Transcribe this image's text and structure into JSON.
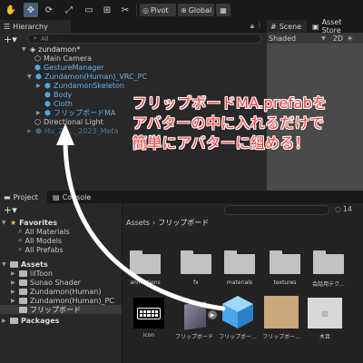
{
  "toolbar": {
    "pivot_label": "Pivot",
    "global_label": "Global",
    "store_label": "Asset Store"
  },
  "hierarchy": {
    "tab_label": "Hierarchy",
    "search_placeholder": "All",
    "scene_name": "zundamon*",
    "items": [
      {
        "label": "Main Camera"
      },
      {
        "label": "GestureManager"
      },
      {
        "label": "Zundamon(Human)_VRC_PC"
      },
      {
        "label": "ZundamonSkeleton"
      },
      {
        "label": "Body"
      },
      {
        "label": "Cloth"
      },
      {
        "label": "フリップボードMA"
      },
      {
        "label": "Directional Light"
      },
      {
        "label": "Hu_Zu..._2023_Meta"
      }
    ]
  },
  "scene": {
    "tab_scene": "Scene",
    "tab_store": "Asset Store",
    "shading": "Shaded",
    "mode_2d": "2D"
  },
  "annotation": {
    "line1": "フリップボードMA.prefabを",
    "line2": "アバターの中に入れるだけで",
    "line3": "簡単にアバターに組める！"
  },
  "project": {
    "tab_project": "Project",
    "tab_console": "Console",
    "breadcrumb_root": "Assets",
    "breadcrumb_sep": "›",
    "breadcrumb_current": "フリップボード",
    "count": "14",
    "favorites_label": "Favorites",
    "favorites": [
      {
        "label": "All Materials"
      },
      {
        "label": "All Models"
      },
      {
        "label": "All Prefabs"
      }
    ],
    "assets_label": "Assets",
    "folders": [
      {
        "label": "lilToon"
      },
      {
        "label": "Sunao Shader"
      },
      {
        "label": "Zundamon(Human)"
      },
      {
        "label": "Zundamon(Human)_PC"
      },
      {
        "label": "フリップボード"
      }
    ],
    "packages_label": "Packages",
    "grid_row1": [
      {
        "label": "animations"
      },
      {
        "label": "fx"
      },
      {
        "label": "materials"
      },
      {
        "label": "textures"
      },
      {
        "label": "会話用テク..."
      }
    ],
    "grid_row2": [
      {
        "label": "icon"
      },
      {
        "label": "フリップボード"
      },
      {
        "label": "フリップボー..."
      },
      {
        "label": "フリップボー..."
      },
      {
        "label": "木目"
      }
    ]
  },
  "colors": {
    "annotation_text": "#ff3a3a",
    "annotation_outline": "#ffffff",
    "prefab_blue": "#66b2f0",
    "active_tool": "#46607c"
  }
}
